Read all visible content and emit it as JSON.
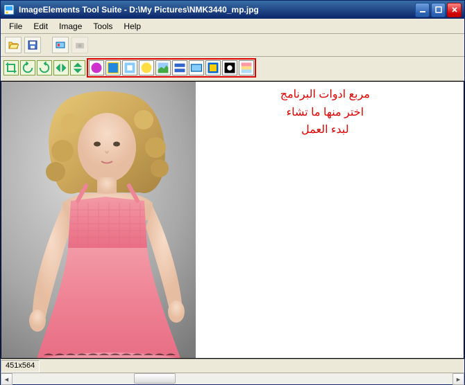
{
  "titlebar": {
    "title": "ImageElements Tool Suite - D:\\My Pictures\\NMK3440_mp.jpg"
  },
  "menubar": {
    "items": [
      "File",
      "Edit",
      "Image",
      "Tools",
      "Help"
    ]
  },
  "toolbar1_icons": [
    "open-icon",
    "save-icon",
    "spacer",
    "process-icon",
    "camera-icon"
  ],
  "toolbar2_icons": [
    "crop-icon",
    "rotate-left-icon",
    "rotate-right-icon",
    "flip-h-icon",
    "flip-v-icon"
  ],
  "toolbar3_icons": [
    "effect-1-icon",
    "effect-2-icon",
    "effect-3-icon",
    "effect-4-icon",
    "effect-5-icon",
    "effect-6-icon",
    "effect-7-icon",
    "effect-8-icon",
    "effect-9-icon",
    "effect-10-icon"
  ],
  "annotation": {
    "line1": "مربع ادوات البرنامج",
    "line2": "اختر منها ما تشاء",
    "line3": "لبدء العمل"
  },
  "status": {
    "dimensions": "451x564"
  }
}
